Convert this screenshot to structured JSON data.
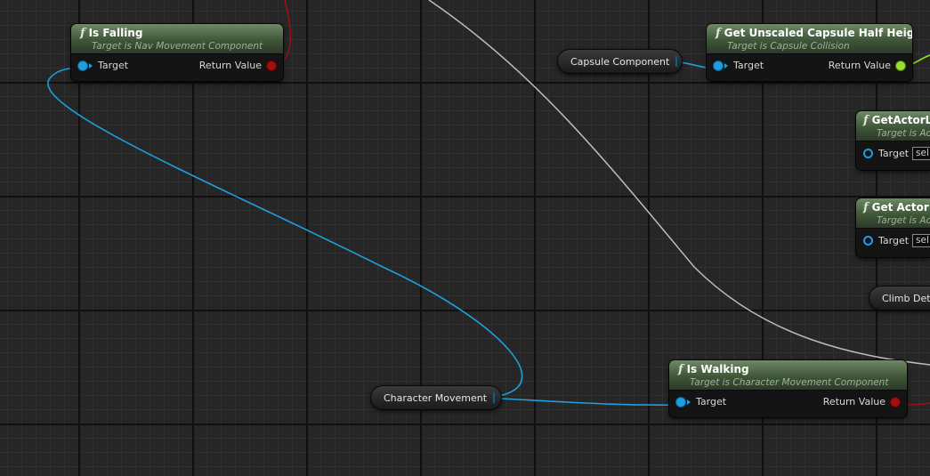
{
  "nodes": {
    "is_falling": {
      "title": "Is Falling",
      "subtitle": "Target is Nav Movement Component",
      "input": "Target",
      "output": "Return Value"
    },
    "get_capsule_half_height": {
      "title": "Get Unscaled Capsule Half Height",
      "subtitle": "Target is Capsule Collision",
      "input": "Target",
      "output": "Return Value"
    },
    "get_actor_location": {
      "title": "GetActorLo",
      "subtitle": "Target is Ac",
      "input": "Target",
      "default": "sel"
    },
    "get_actor_forward": {
      "title": "Get Actor F",
      "subtitle": "Target is Ac",
      "input": "Target",
      "default": "sel"
    },
    "is_walking": {
      "title": "Is Walking",
      "subtitle": "Target is Character Movement Component",
      "input": "Target",
      "output": "Return Value"
    }
  },
  "variables": {
    "capsule_component": "Capsule Component",
    "character_movement": "Character Movement",
    "climb_detect": "Climb Dete"
  },
  "colors": {
    "object_pin": "#1f9ee0",
    "bool_pin": "#a40e0e",
    "float_pin": "#96e030",
    "header": "#3f5639",
    "wire_exec": "#bdbdbd"
  }
}
